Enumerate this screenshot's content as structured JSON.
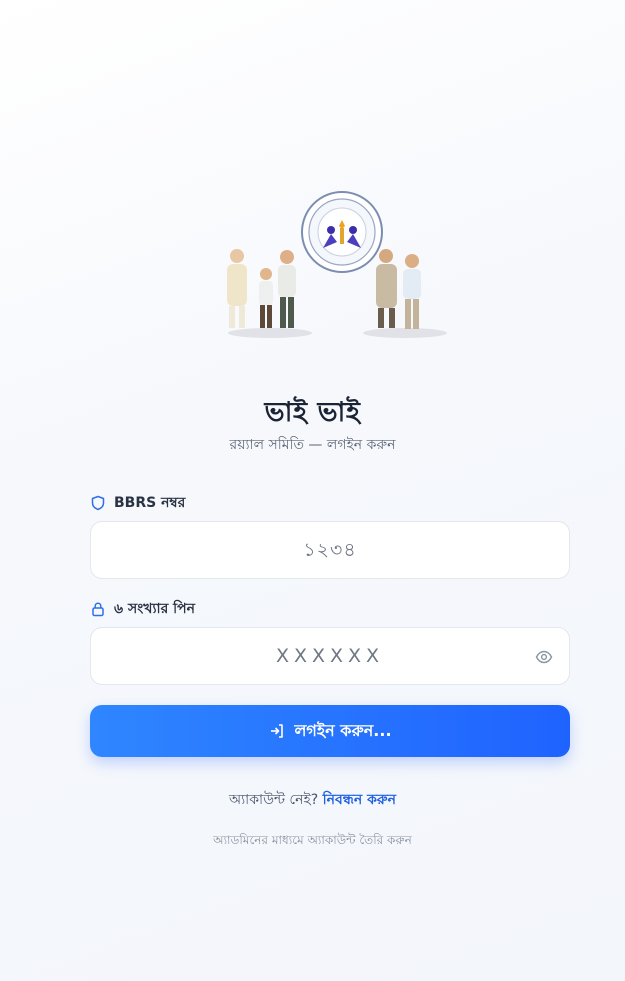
{
  "header": {
    "title": "ভাই ভাই",
    "subtitle": "রয়্যাল সমিতি — লগইন করুন"
  },
  "form": {
    "bbrs": {
      "label": "BBRS নম্বর",
      "placeholder": "১২৩৪",
      "icon": "shield-icon"
    },
    "pin": {
      "label": "৬ সংখ্যার পিন",
      "placeholder": "XXXXXX",
      "icon": "lock-icon",
      "toggle_icon": "eye-icon"
    },
    "submit": {
      "label": "লগইন করুন...",
      "icon": "login-arrow-icon"
    }
  },
  "footer": {
    "register_prompt": "অ্যাকাউন্ট নেই?",
    "register_link": "নিবন্ধন করুন",
    "admin_note": "অ্যাডমিনের মাধ্যমে অ্যাকাউন্ট তৈরি করুন"
  },
  "colors": {
    "accent": "#1f63ff",
    "accent_light": "#2f86ff",
    "title": "#1b2436",
    "link": "#1d5fe6"
  }
}
